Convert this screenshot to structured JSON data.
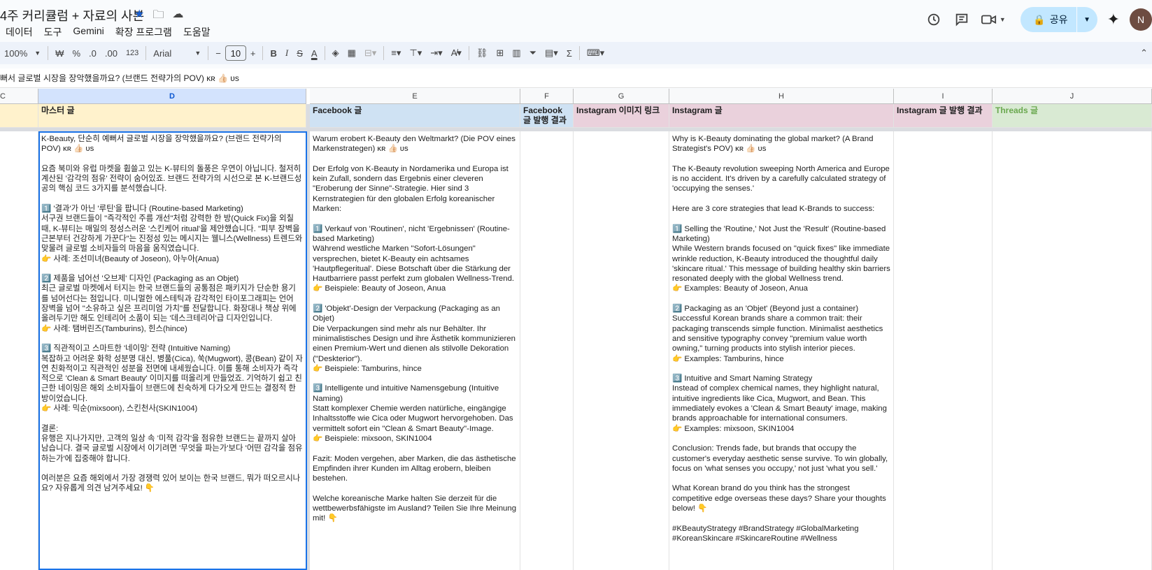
{
  "title_bar": {
    "doc_title": "4주 커리큘럼 + 자료의 사본",
    "share_label": "공유",
    "avatar_letter": "N"
  },
  "menu": [
    "데이터",
    "도구",
    "Gemini",
    "확장 프로그램",
    "도움말"
  ],
  "toolbar": {
    "zoom": "100%",
    "currency": "₩",
    "percent": "%",
    "dec_less": ".0",
    "dec_more": ".00",
    "number_format": "123",
    "font": "Arial",
    "font_size": "10"
  },
  "formula_bar": "뻐서 글로벌 시장을 장악했을까요? (브랜드 전략가의 POV) ᴋʀ 👍🏻 ᴜs",
  "columns": [
    {
      "letter": "C",
      "header": ""
    },
    {
      "letter": "D",
      "header": "마스터 글"
    },
    {
      "letter": "E",
      "header": "Facebook 글"
    },
    {
      "letter": "F",
      "header": "Facebook 글 발행 결과"
    },
    {
      "letter": "G",
      "header": "Instagram 이미지 링크"
    },
    {
      "letter": "H",
      "header": "Instagram 글"
    },
    {
      "letter": "I",
      "header": "Instagram 글 발행 결과"
    },
    {
      "letter": "J",
      "header": "Threads 글"
    }
  ],
  "cells": {
    "D": "K-Beauty, 단순히 예뻐서 글로벌 시장을 장악했을까요? (브랜드 전략가의 POV) ᴋʀ 👍🏻 ᴜs\n\n요즘 북미와 유럽 마켓을 휩쓸고 있는 K-뷰티의 돌풍은 우연이 아닙니다. 철저히 계산된 '감각의 점유' 전략이 숨어있죠. 브랜드 전략가의 시선으로 본 K-브랜드성공의 핵심 코드 3가지를 분석했습니다.\n\n1️⃣ '결과'가 아닌 '루틴'을 팝니다 (Routine-based Marketing)\n서구권 브랜드들이 \"즉각적인 주름 개선\"처럼 강력한 한 방(Quick Fix)을 외칠 때, K-뷰티는 매일의 정성스러운 '스킨케어 ritual'을 제안했습니다. \"피부 장벽을 근본부터 건강하게 가꾼다\"는 진정성 있는 메시지는 웰니스(Wellness) 트렌드와 맞물려 글로벌 소비자들의 마음을 움직였습니다.\n👉 사례: 조선미녀(Beauty of Joseon), 아누아(Anua)\n\n2️⃣ 제품을 넘어선 '오브제' 디자인 (Packaging as an Objet)\n최근 글로벌 마켓에서 터지는 한국 브랜드들의 공통점은 패키지가 단순한 용기를 넘어선다는 점입니다. 미니멀한 에스테틱과 감각적인 타이포그래피는 언어 장벽을 넘어 \"소유하고 싶은 프리미엄 가치\"를 전달합니다. 화장대나 책상 위에 올려두기만 해도 인테리어 소품이 되는 '데스크테리어'급 디자인입니다.\n👉 사례: 탬버린즈(Tamburins), 힌스(hince)\n\n3️⃣ 직관적이고 스마트한 '네이밍' 전략 (Intuitive Naming)\n복잡하고 어려운 화학 성분명 대신, 병풀(Cica), 쑥(Mugwort), 콩(Bean) 같이 자연 친화적이고 직관적인 성분을 전면에 내세웠습니다. 이를 통해 소비자가 즉각적으로 'Clean & Smart Beauty' 이미지를 떠올리게 만들었죠. 기억하기 쉽고 친근한 네이밍은 해외 소비자들이 브랜드에 친숙하게 다가오게 만드는 결정적 한 방이었습니다.\n👉 사례: 믹순(mixsoon), 스킨천사(SKIN1004)\n\n결론:\n유행은 지나가지만, 고객의 일상 속 '미적 감각'을 점유한 브랜드는 끝까지 살아남습니다. 결국 글로벌 시장에서 이기려면 '무엇을 파는가'보다 '어떤 감각을 점유하는가'에 집중해야 합니다.\n\n여러분은 요즘 해외에서 가장 경쟁력 있어 보이는 한국 브랜드, 뭐가 떠오르시나요? 자유롭게 의견 남겨주세요! 👇",
    "E": "Warum erobert K-Beauty den Weltmarkt? (Die POV eines Markenstrategen) ᴋʀ 👍🏻 ᴜs\n\nDer Erfolg von K-Beauty in Nordamerika und Europa ist kein Zufall, sondern das Ergebnis einer cleveren \"Eroberung der Sinne\"-Strategie. Hier sind 3 Kernstrategien für den globalen Erfolg koreanischer Marken:\n\n1️⃣ Verkauf von 'Routinen', nicht 'Ergebnissen' (Routine-based Marketing)\nWährend westliche Marken \"Sofort-Lösungen\" versprechen, bietet K-Beauty ein achtsames 'Hautpflegeritual'. Diese Botschaft über die Stärkung der Hautbarriere passt perfekt zum globalen Wellness-Trend.\n👉 Beispiele: Beauty of Joseon, Anua\n\n2️⃣ 'Objekt'-Design der Verpackung (Packaging as an Objet)\nDie Verpackungen sind mehr als nur Behälter. Ihr minimalistisches Design und ihre Ästhetik kommunizieren einen Premium-Wert und dienen als stilvolle Dekoration (\"Deskterior\").\n👉 Beispiele: Tamburins, hince\n\n3️⃣ Intelligente und intuitive Namensgebung (Intuitive Naming)\nStatt komplexer Chemie werden natürliche, eingängige Inhaltsstoffe wie Cica oder Mugwort hervorgehoben. Das vermittelt sofort ein \"Clean & Smart Beauty\"-Image.\n👉 Beispiele: mixsoon, SKIN1004\n\nFazit: Moden vergehen, aber Marken, die das ästhetische Empfinden ihrer Kunden im Alltag erobern, bleiben bestehen.\n\nWelche koreanische Marke halten Sie derzeit für die wettbewerbsfähigste im Ausland? Teilen Sie Ihre Meinung mit! 👇",
    "H": "Why is K-Beauty dominating the global market? (A Brand Strategist's POV) ᴋʀ 👍🏻 ᴜs\n\nThe K-Beauty revolution sweeping North America and Europe is no accident. It's driven by a carefully calculated strategy of 'occupying the senses.'\n\nHere are 3 core strategies that lead K-Brands to success:\n\n1️⃣ Selling the 'Routine,' Not Just the 'Result' (Routine-based Marketing)\nWhile Western brands focused on \"quick fixes\" like immediate wrinkle reduction, K-Beauty introduced the thoughtful daily 'skincare ritual.' This message of building healthy skin barriers resonated deeply with the global Wellness trend.\n👉 Examples: Beauty of Joseon, Anua\n\n2️⃣ Packaging as an 'Objet' (Beyond just a container)\nSuccessful Korean brands share a common trait: their packaging transcends simple function. Minimalist aesthetics and sensitive typography convey \"premium value worth owning,\" turning products into stylish interior pieces.\n👉 Examples: Tamburins, hince\n\n3️⃣ Intuitive and Smart Naming Strategy\nInstead of complex chemical names, they highlight natural, intuitive ingredients like Cica, Mugwort, and Bean. This immediately evokes a 'Clean & Smart Beauty' image, making brands approachable for international consumers.\n👉 Examples: mixsoon, SKIN1004\n\nConclusion: Trends fade, but brands that occupy the customer's everyday aesthetic sense survive. To win globally, focus on 'what senses you occupy,' not just 'what you sell.'\n\nWhat Korean brand do you think has the strongest competitive edge overseas these days? Share your thoughts below! 👇\n\n#KBeautyStrategy #BrandStrategy #GlobalMarketing #KoreanSkincare #SkincareRoutine #Wellness"
  },
  "colors": {
    "header_yellow": "#fff2cc",
    "header_blue": "#cfe2f3",
    "header_pink": "#ead1dc",
    "header_green": "#d9ead3",
    "threads_text": "#6aa84f",
    "selection": "#1a73e8"
  }
}
